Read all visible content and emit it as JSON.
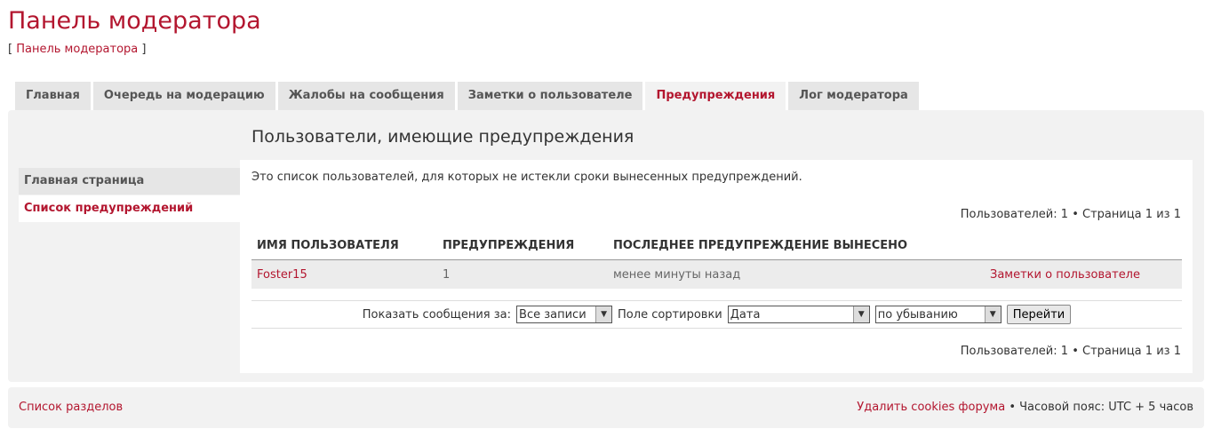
{
  "header": {
    "title": "Панель модератора",
    "breadcrumb_open": "[",
    "breadcrumb_link": "Панель модератора",
    "breadcrumb_close": "]"
  },
  "tabs": [
    {
      "label": "Главная"
    },
    {
      "label": "Очередь на модерацию"
    },
    {
      "label": "Жалобы на сообщения"
    },
    {
      "label": "Заметки о пользователе"
    },
    {
      "label": "Предупреждения"
    },
    {
      "label": "Лог модератора"
    }
  ],
  "sidebar": {
    "items": [
      {
        "label": "Главная страница"
      },
      {
        "label": "Список предупреждений"
      }
    ]
  },
  "main": {
    "title": "Пользователи, имеющие предупреждения",
    "intro": "Это список пользователей, для которых не истекли сроки вынесенных предупреждений.",
    "pager": {
      "users_label": "Пользователей: 1",
      "bullet": "•",
      "page_label": "Страница",
      "page_current": "1",
      "page_of": "из",
      "page_total": "1"
    },
    "table": {
      "headers": [
        "Имя пользователя",
        "Предупреждения",
        "Последнее предупреждение вынесено",
        ""
      ],
      "rows": [
        {
          "username": "Foster15",
          "warnings": "1",
          "last_warning": "менее минуты назад",
          "notes_link": "Заметки о пользователе"
        }
      ]
    },
    "filter": {
      "show_label": "Показать сообщения за:",
      "show_value": "Все записи",
      "sort_label": "Поле сортировки",
      "sort_value": "Дата",
      "order_value": "по убыванию",
      "go_label": "Перейти"
    }
  },
  "footer": {
    "index_link": "Список разделов",
    "delete_cookies": "Удалить cookies форума",
    "bullet": "•",
    "timezone": "Часовой пояс: UTC + 5 часов"
  }
}
